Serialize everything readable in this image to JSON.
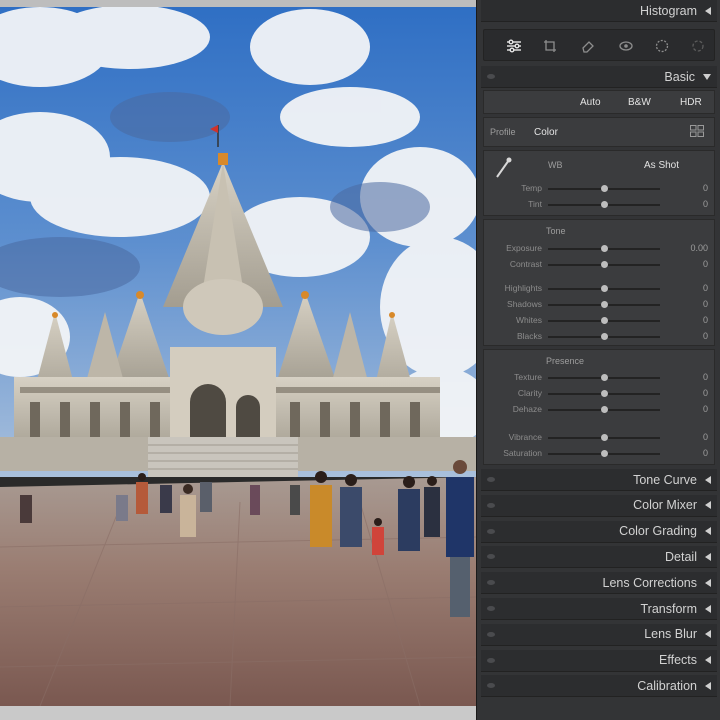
{
  "panel": {
    "histogram_label": "Histogram",
    "basic_label": "Basic",
    "treatment": {
      "auto": "Auto",
      "bw": "B&W",
      "hdr": "HDR"
    },
    "profile": {
      "label": "Profile",
      "value": "Color"
    },
    "wb": {
      "label": "WB",
      "value": "As Shot"
    },
    "sliders_wb": [
      {
        "label": "Temp",
        "value": "0",
        "level": 0.5
      },
      {
        "label": "Tint",
        "value": "0",
        "level": 0.5
      }
    ],
    "tone_label": "Tone",
    "sliders_tone": [
      {
        "label": "Exposure",
        "value": "0.00",
        "level": 0.5
      },
      {
        "label": "Contrast",
        "value": "0",
        "level": 0.5
      },
      {
        "label": "Highlights",
        "value": "0",
        "level": 0.5
      },
      {
        "label": "Shadows",
        "value": "0",
        "level": 0.5
      },
      {
        "label": "Whites",
        "value": "0",
        "level": 0.5
      },
      {
        "label": "Blacks",
        "value": "0",
        "level": 0.5
      }
    ],
    "presence_label": "Presence",
    "sliders_presence": [
      {
        "label": "Texture",
        "value": "0",
        "level": 0.5
      },
      {
        "label": "Clarity",
        "value": "0",
        "level": 0.5
      },
      {
        "label": "Dehaze",
        "value": "0",
        "level": 0.5
      },
      {
        "label": "Vibrance",
        "value": "0",
        "level": 0.5
      },
      {
        "label": "Saturation",
        "value": "0",
        "level": 0.5
      }
    ],
    "sections": [
      "Tone Curve",
      "Color Mixer",
      "Color Grading",
      "Detail",
      "Lens Corrections",
      "Transform",
      "Lens Blur",
      "Effects",
      "Calibration"
    ],
    "tools": [
      "edit-sliders-icon",
      "crop-rotate-icon",
      "eraser-icon",
      "redeye-icon",
      "masking-icon",
      "presets-icon"
    ]
  }
}
